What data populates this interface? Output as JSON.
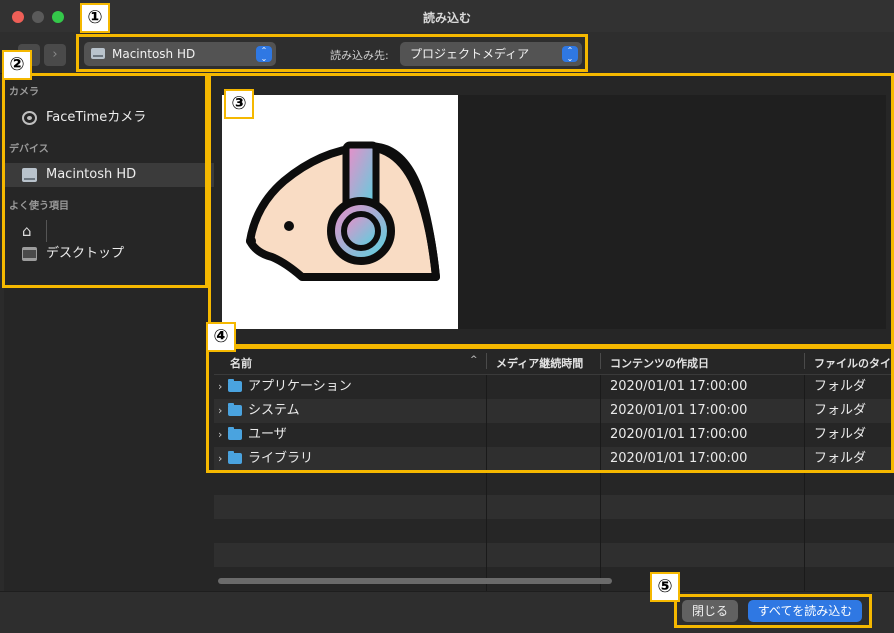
{
  "window": {
    "title": "読み込む"
  },
  "toolbar": {
    "disk_popup": "Macintosh HD",
    "dest_label": "読み込み先:",
    "dest_popup": "プロジェクトメディア",
    "back_glyph": "‹",
    "forward_glyph": "›"
  },
  "sidebar": {
    "sections": [
      {
        "heading": "カメラ",
        "items": [
          {
            "label": "FaceTimeカメラ",
            "icon": "camera-icon"
          }
        ]
      },
      {
        "heading": "デバイス",
        "items": [
          {
            "label": "Macintosh HD",
            "icon": "disk-icon",
            "selected": true
          }
        ]
      },
      {
        "heading": "よく使う項目",
        "items": [
          {
            "label": "",
            "icon": "home-icon"
          },
          {
            "label": "デスクトップ",
            "icon": "desktop-icon"
          }
        ]
      }
    ]
  },
  "file_list": {
    "columns": [
      "名前",
      "メディア継続時間",
      "コンテンツの作成日",
      "ファイルのタイプ"
    ],
    "rows": [
      {
        "name": "アプリケーション",
        "duration": "",
        "created": "2020/01/01 17:00:00",
        "kind": "フォルダ"
      },
      {
        "name": "システム",
        "duration": "",
        "created": "2020/01/01 17:00:00",
        "kind": "フォルダ"
      },
      {
        "name": "ユーザ",
        "duration": "",
        "created": "2020/01/01 17:00:00",
        "kind": "フォルダ"
      },
      {
        "name": "ライブラリ",
        "duration": "",
        "created": "2020/01/01 17:00:00",
        "kind": "フォルダ"
      }
    ]
  },
  "footer": {
    "close_label": "閉じる",
    "import_all_label": "すべてを読み込む"
  },
  "annotations": {
    "markers": [
      "①",
      "②",
      "③",
      "④",
      "⑤"
    ],
    "color": "#f5b800"
  },
  "colors": {
    "accent_blue": "#2f78e3",
    "folder_blue": "#4aa3df",
    "window_bg": "#2b2b2b"
  }
}
